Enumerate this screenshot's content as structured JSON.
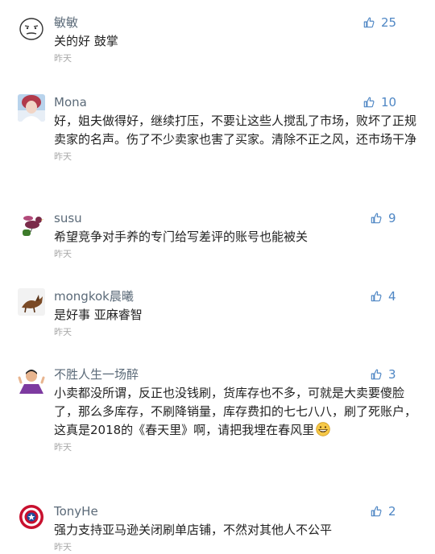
{
  "comments": [
    {
      "username": "敏敏",
      "text": "关的好 鼓掌",
      "time": "昨天",
      "likes": "25",
      "avatar_icon": "meme-face-avatar"
    },
    {
      "username": "Mona",
      "text": "好，姐夫做得好，继续打压，不要让这些人搅乱了市场，败坏了正规卖家的名声。伤了不少卖家也害了买家。清除不正之风，还市场干净",
      "time": "昨天",
      "likes": "10",
      "avatar_icon": "photo-avatar"
    },
    {
      "username": "susu",
      "text": "希望竞争对手养的专门给写差评的账号也能被关",
      "time": "昨天",
      "likes": "9",
      "avatar_icon": "bird-avatar"
    },
    {
      "username": "mongkok晨曦",
      "text": "是好事 亚麻睿智",
      "time": "昨天",
      "likes": "4",
      "avatar_icon": "animal-avatar"
    },
    {
      "username": "不胜人生一场醉",
      "text": "小卖都没所谓，反正也没钱刷，货库存也不多，可就是大卖要傻脸了，那么多库存，不刷降销量，库存费扣的七七八八，刷了死账户，这真是2018的《春天里》啊，请把我埋在春风里",
      "time": "昨天",
      "likes": "3",
      "avatar_icon": "person-avatar",
      "emoji": "grinning-emoji"
    },
    {
      "username": "TonyHe",
      "text": "强力支持亚马逊关闭刷单店铺，不然对其他人不公平",
      "time": "昨天",
      "likes": "2",
      "avatar_icon": "shield-avatar"
    }
  ],
  "colors": {
    "username": "#5b6a78",
    "text": "#222222",
    "time": "#a8a8a8",
    "like": "#4e86c4"
  }
}
